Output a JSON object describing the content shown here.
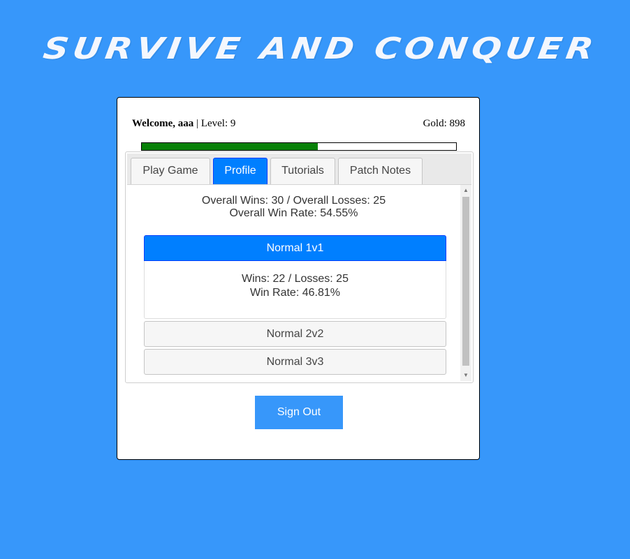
{
  "header": {
    "title": "SURVIVE AND CONQUER"
  },
  "player": {
    "welcome_label": "Welcome, aaa",
    "separator": " | ",
    "level_text": "Level: 9",
    "gold_text": "Gold: 898",
    "xp_progress": 0.56
  },
  "tabs": [
    {
      "label": "Play Game",
      "active": false
    },
    {
      "label": "Profile",
      "active": true
    },
    {
      "label": "Tutorials",
      "active": false
    },
    {
      "label": "Patch Notes",
      "active": false
    }
  ],
  "profile": {
    "overall_record": "Overall Wins: 30 / Overall Losses: 25",
    "overall_win_rate": "Overall Win Rate: 54.55%",
    "modes": [
      {
        "label": "Normal 1v1",
        "expanded": true,
        "record": "Wins: 22 / Losses: 25",
        "win_rate": "Win Rate: 46.81%"
      },
      {
        "label": "Normal 2v2",
        "expanded": false
      },
      {
        "label": "Normal 3v3",
        "expanded": false
      }
    ]
  },
  "actions": {
    "sign_out_label": "Sign Out"
  },
  "colors": {
    "background": "#3797fa",
    "active_tab": "#007fff",
    "xp_fill": "#078007",
    "sign_out_button": "#3797fa"
  },
  "icons": {
    "scroll_up": "scroll-up-arrow-icon",
    "scroll_down": "scroll-down-arrow-icon"
  }
}
